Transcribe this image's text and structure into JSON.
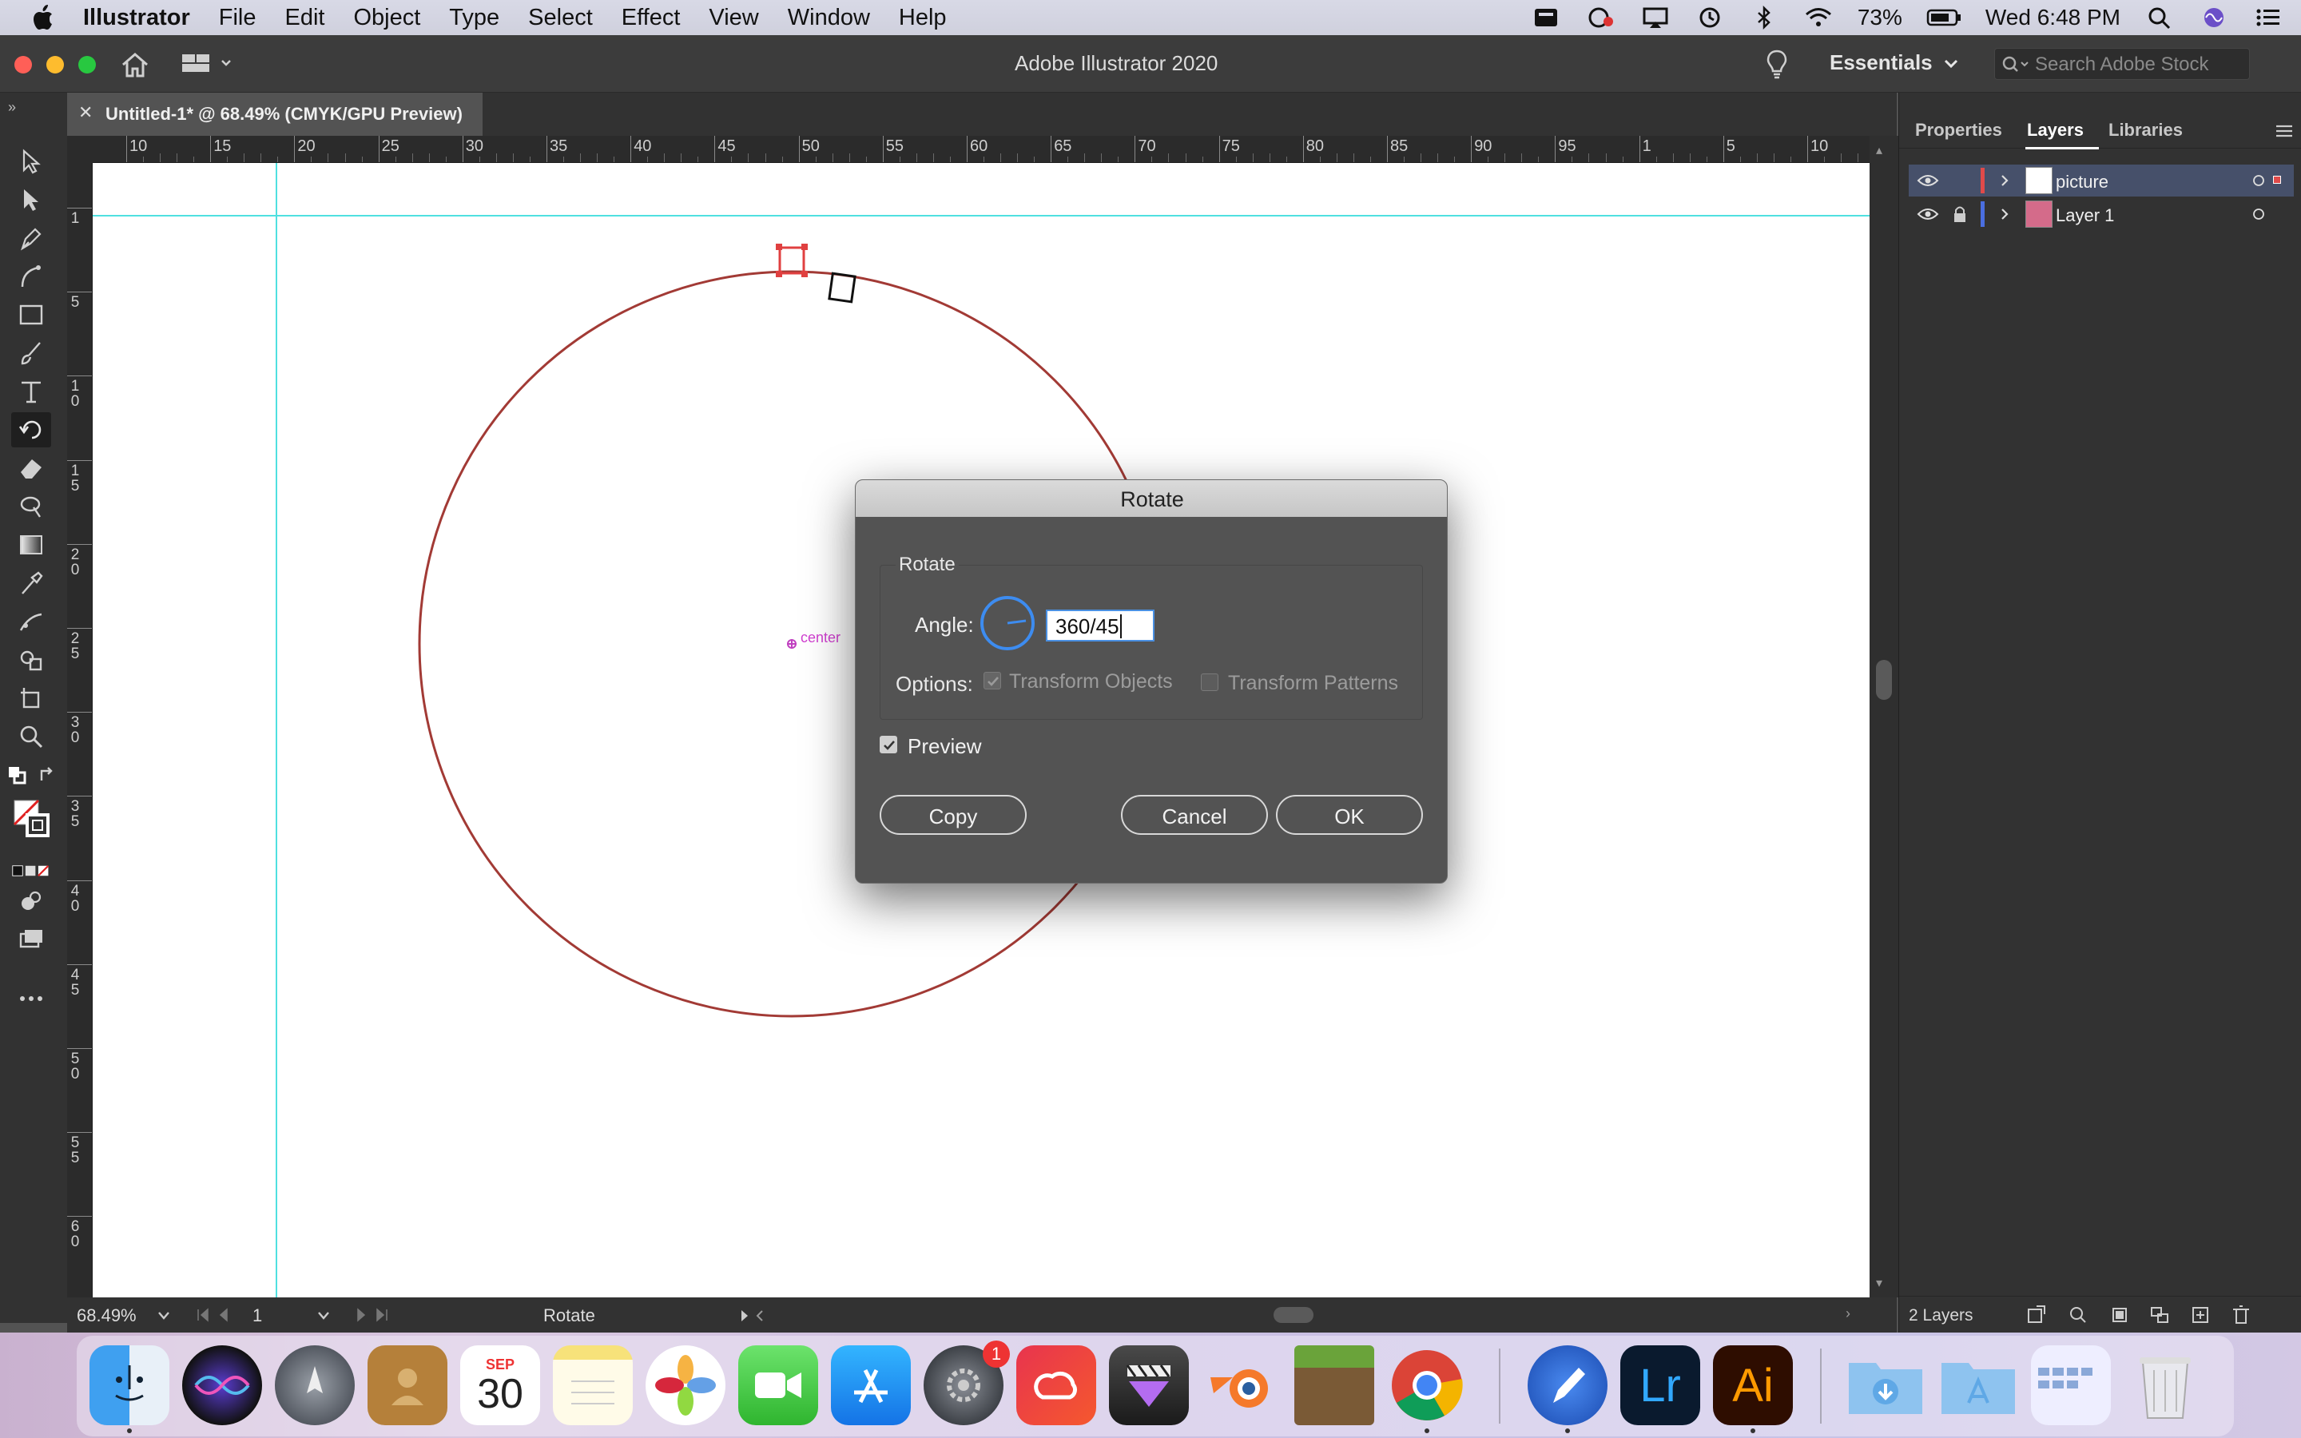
{
  "menubar": {
    "app_name": "Illustrator",
    "items": [
      "File",
      "Edit",
      "Object",
      "Type",
      "Select",
      "Effect",
      "View",
      "Window",
      "Help"
    ],
    "battery": "73%",
    "clock": "Wed 6:48 PM"
  },
  "window": {
    "title": "Adobe Illustrator 2020",
    "workspace": "Essentials",
    "stock_search_placeholder": "Search Adobe Stock"
  },
  "document": {
    "tab_title": "Untitled-1* @ 68.49% (CMYK/GPU Preview)",
    "close_glyph": "✕"
  },
  "rulers": {
    "horizontal_ticks": [
      "10",
      "15",
      "20",
      "25",
      "30",
      "35",
      "40",
      "45",
      "50",
      "55",
      "60",
      "65",
      "70",
      "75",
      "80",
      "85",
      "90",
      "95",
      "1",
      "5",
      "10"
    ],
    "vertical_ticks": [
      "1",
      "5",
      "10",
      "15",
      "20",
      "25",
      "30",
      "35",
      "40",
      "45",
      "50",
      "55",
      "60"
    ]
  },
  "canvas": {
    "center_label": "center",
    "circle_color": "#a23a35",
    "guide_color": "#4fe0e0"
  },
  "status": {
    "zoom": "68.49%",
    "page": "1",
    "current_tool": "Rotate"
  },
  "panel": {
    "tabs": [
      "Properties",
      "Layers",
      "Libraries"
    ],
    "active_tab": "Layers",
    "layers": [
      {
        "name": "picture",
        "color": "#e04a4a",
        "active": true
      },
      {
        "name": "Layer 1",
        "color": "#4a6ee0",
        "active": false,
        "locked": true
      }
    ],
    "layer_count": "2 Layers"
  },
  "dialog": {
    "title": "Rotate",
    "group_label": "Rotate",
    "angle_label": "Angle:",
    "angle_value": "360/45",
    "options_label": "Options:",
    "transform_objects": "Transform Objects",
    "transform_patterns": "Transform Patterns",
    "preview_label": "Preview",
    "preview_checked": true,
    "copy_button": "Copy",
    "cancel_button": "Cancel",
    "ok_button": "OK"
  },
  "dock": {
    "apps": [
      "finder-icon",
      "siri-icon",
      "launchpad-icon",
      "contacts-icon",
      "calendar-icon",
      "notes-icon",
      "photos-icon",
      "facetime-icon",
      "appstore-icon",
      "system-preferences-icon",
      "creative-cloud-icon",
      "final-cut-icon",
      "blender-icon",
      "minecraft-icon",
      "chrome-icon",
      "pixelmator-icon",
      "lightroom-icon",
      "illustrator-icon",
      "downloads-folder-icon",
      "applications-folder-icon",
      "screenshot-icon",
      "trash-icon"
    ],
    "calendar_month": "SEP",
    "calendar_day": "30",
    "sysprefs_badge": "1",
    "lightroom_label": "Lr",
    "illustrator_label": "Ai"
  }
}
